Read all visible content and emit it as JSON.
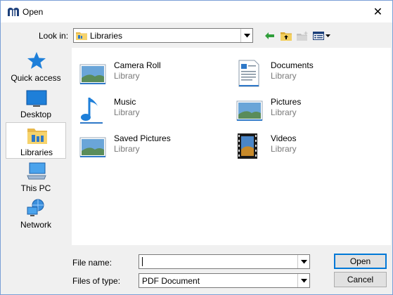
{
  "window": {
    "title": "Open",
    "close_glyph": "✕"
  },
  "toolbar": {
    "look_in_label": "Look in:",
    "look_in_value": "Libraries",
    "buttons": [
      "back-icon",
      "up-folder-icon",
      "new-folder-icon",
      "view-menu-icon"
    ]
  },
  "places": [
    {
      "label": "Quick access",
      "icon": "quick-access-star-icon"
    },
    {
      "label": "Desktop",
      "icon": "desktop-icon"
    },
    {
      "label": "Libraries",
      "icon": "libraries-icon",
      "selected": true
    },
    {
      "label": "This PC",
      "icon": "this-pc-icon"
    },
    {
      "label": "Network",
      "icon": "network-icon"
    }
  ],
  "items": [
    {
      "name": "Camera Roll",
      "type": "Library",
      "icon": "picture-library-icon"
    },
    {
      "name": "Documents",
      "type": "Library",
      "icon": "documents-library-icon"
    },
    {
      "name": "Music",
      "type": "Library",
      "icon": "music-note-icon"
    },
    {
      "name": "Pictures",
      "type": "Library",
      "icon": "picture-library-icon"
    },
    {
      "name": "Saved Pictures",
      "type": "Library",
      "icon": "picture-library-icon"
    },
    {
      "name": "Videos",
      "type": "Library",
      "icon": "video-film-icon"
    }
  ],
  "footer": {
    "file_name_label": "File name:",
    "file_name_value": "",
    "file_type_label": "Files of type:",
    "file_type_value": "PDF Document",
    "open_label": "Open",
    "cancel_label": "Cancel"
  },
  "colors": {
    "accent": "#0078d7",
    "border": "#7a9fd6",
    "muted_text": "#7a7a7a"
  }
}
